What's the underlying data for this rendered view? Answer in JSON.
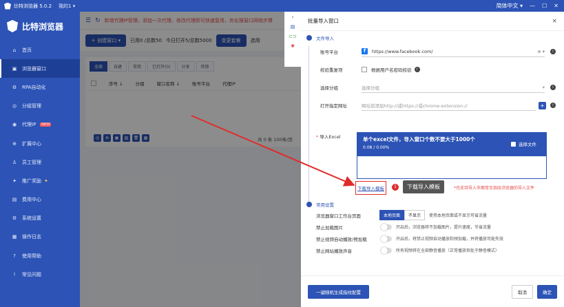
{
  "titlebar": {
    "app_title": "比特浏览器 5.0.2",
    "account": "我的1 ▾",
    "lang": "简体中文 ▾",
    "minimize": "—",
    "maximize": "☐",
    "close": "✕"
  },
  "sidebar": {
    "brand": "比特浏览器",
    "items": [
      {
        "icon": "⌂",
        "label": "首页"
      },
      {
        "icon": "▣",
        "label": "浏览器窗口",
        "active": true
      },
      {
        "icon": "⚙",
        "label": "RPA自动化"
      },
      {
        "icon": "◎",
        "label": "分组管理"
      },
      {
        "icon": "◉",
        "label": "代理IP",
        "badge": "NEW"
      },
      {
        "icon": "⊕",
        "label": "扩展中心"
      },
      {
        "icon": "♙",
        "label": "员工管理"
      },
      {
        "icon": "✦",
        "label": "推广奖励"
      },
      {
        "icon": "▤",
        "label": "费用中心"
      },
      {
        "icon": "⚙",
        "label": "系统设置"
      },
      {
        "icon": "▦",
        "label": "操作日志"
      },
      {
        "icon": "?",
        "label": "使用帮助"
      },
      {
        "icon": "!",
        "label": "常见问题"
      }
    ]
  },
  "main": {
    "notice": "新增代理IP管理，添加一次代理，修改代理即可快速复用，优化搜窗口网络步骤",
    "create_btn": "创建窗口",
    "stats": [
      "已用0 /总数50",
      "今日打开5/总数5000"
    ],
    "change_pkg": "变更套餐",
    "extra_btn": "选用",
    "tabs": [
      "全部",
      "自建",
      "常用",
      "已打开(0)",
      "分享",
      "转移"
    ],
    "table_headers": [
      "序号 ↓",
      "分组",
      "窗口名称 ↓",
      "账号平台",
      "代理IP"
    ],
    "pagination": "共 0 条  100条/页"
  },
  "modal": {
    "title": "批量导入窗口",
    "close": "×",
    "section_import": "文件导入",
    "platform_label": "账号平台",
    "platform_value": "https://www.facebook.com/",
    "dedup_label": "校验重复项",
    "dedup_text": "根据用户名密码校验",
    "group_label": "选择分组",
    "group_placeholder": "选择分组",
    "url_label": "打开指定网址",
    "url_placeholder": "网址前添加http://或https://或chrome-extension://",
    "excel_label": "导入Excel",
    "upload_title": "单个excel文件，导入窗口个数不要大于1000个",
    "upload_progress": "0.08 / 0.00%",
    "select_file": "选择文件",
    "download_template": "下载导入模板",
    "tip_number": "1",
    "tip_text": "下载导入模板",
    "hint": "*也支持导入市面常见指纹浏览器的导入文件",
    "section_settings": "常用设置",
    "workbench_label": "浏览器窗口工作台页面",
    "workbench_on": "本地页面",
    "workbench_off": "不显示",
    "workbench_desc": "使用本地页面或不显示可省流量",
    "settings": [
      {
        "label": "禁止加载图片",
        "desc": "开启后，浏览器将不加载图片，提升速度，节省流量"
      },
      {
        "label": "禁止视频自动播放/预加载",
        "desc": "开启后，将禁止视频自动播放和预加载，并将播放可能失效"
      },
      {
        "label": "禁止网站播放声音",
        "desc": "所有视频将在全部静音播放（正常播放但处于静音模式）"
      }
    ],
    "gen_btn": "一键随机生成指纹配置",
    "cancel_btn": "取消",
    "ok_btn": "确定"
  }
}
